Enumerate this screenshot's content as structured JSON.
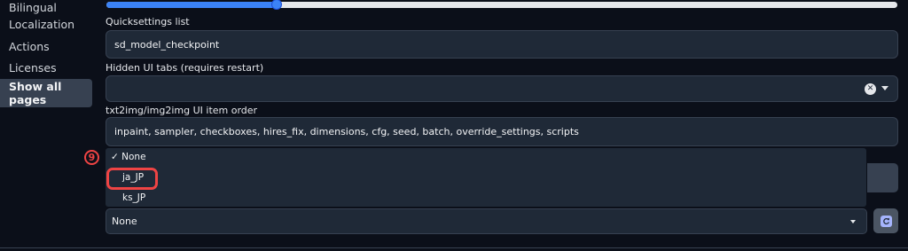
{
  "sidebar": {
    "items": [
      {
        "label": "Bilingual"
      },
      {
        "label": "Localization"
      },
      {
        "label": "Actions"
      },
      {
        "label": "Licenses"
      }
    ],
    "show_all_pages_label": "Show all pages"
  },
  "slider": {
    "value_fraction": 0.215
  },
  "quicksettings": {
    "label": "Quicksettings list",
    "value": "sd_model_checkpoint"
  },
  "hidden_ui_tabs": {
    "label": "Hidden UI tabs (requires restart)",
    "value": "",
    "clear_glyph": "✕"
  },
  "ui_item_order": {
    "label": "txt2img/img2img UI item order",
    "value": "inpaint, sampler, checkboxes, hires_fix, dimensions, cfg, seed, batch, override_settings, scripts"
  },
  "localization_dropdown": {
    "options": [
      {
        "label": "None",
        "selected": true,
        "check_glyph": "✓"
      },
      {
        "label": "ja_JP",
        "selected": false
      },
      {
        "label": "ks_JP",
        "selected": false
      }
    ]
  },
  "annotation": {
    "number": "9",
    "color": "#ef4444"
  },
  "localization_select": {
    "value": "None"
  },
  "icons": {
    "refresh": "refresh-icon",
    "clear": "close-icon",
    "dropdown": "chevron-down-icon"
  },
  "colors": {
    "background": "#0b0f19",
    "panel": "#1f2937",
    "accent": "#3b82f6",
    "annotation": "#ef4444"
  }
}
